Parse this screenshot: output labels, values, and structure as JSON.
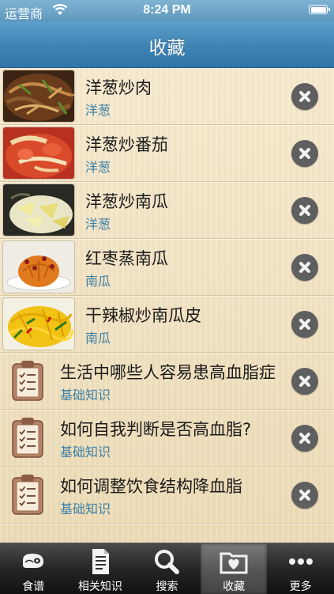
{
  "status_bar": {
    "carrier": "运营商",
    "time": "8:24 PM"
  },
  "nav": {
    "title": "收藏"
  },
  "favorites": [
    {
      "title": "洋葱炒肉",
      "category": "洋葱",
      "kind": "recipe",
      "photo": "stir-fried-pork-with-onion"
    },
    {
      "title": "洋葱炒番茄",
      "category": "洋葱",
      "kind": "recipe",
      "photo": "onion-and-tomato"
    },
    {
      "title": "洋葱炒南瓜",
      "category": "洋葱",
      "kind": "recipe",
      "photo": "onion-and-pumpkin"
    },
    {
      "title": "红枣蒸南瓜",
      "category": "南瓜",
      "kind": "recipe",
      "photo": "steamed-pumpkin-with-dates"
    },
    {
      "title": "干辣椒炒南瓜皮",
      "category": "南瓜",
      "kind": "recipe",
      "photo": "pumpkin-peel-with-chili"
    },
    {
      "title": "生活中哪些人容易患高血脂症",
      "category": "基础知识",
      "kind": "article",
      "icon": "clipboard-icon"
    },
    {
      "title": "如何自我判断是否高血脂?",
      "category": "基础知识",
      "kind": "article",
      "icon": "clipboard-icon"
    },
    {
      "title": "如何调整饮食结构降血脂",
      "category": "基础知识",
      "kind": "article",
      "icon": "clipboard-icon"
    }
  ],
  "tabs": [
    {
      "label": "食谱",
      "icon": "meat-icon",
      "active": false
    },
    {
      "label": "相关知识",
      "icon": "document-icon",
      "active": false
    },
    {
      "label": "搜索",
      "icon": "magnifier-icon",
      "active": false
    },
    {
      "label": "收藏",
      "icon": "heart-folder-icon",
      "active": true
    },
    {
      "label": "更多",
      "icon": "more-dots-icon",
      "active": false
    }
  ],
  "colors": {
    "nav_blue": "#3e83b4",
    "subtitle_blue": "#3a7fa6",
    "list_background": "#f1e4c7",
    "delete_gray": "#5f5f5f",
    "tabbar_dark": "#262626"
  }
}
